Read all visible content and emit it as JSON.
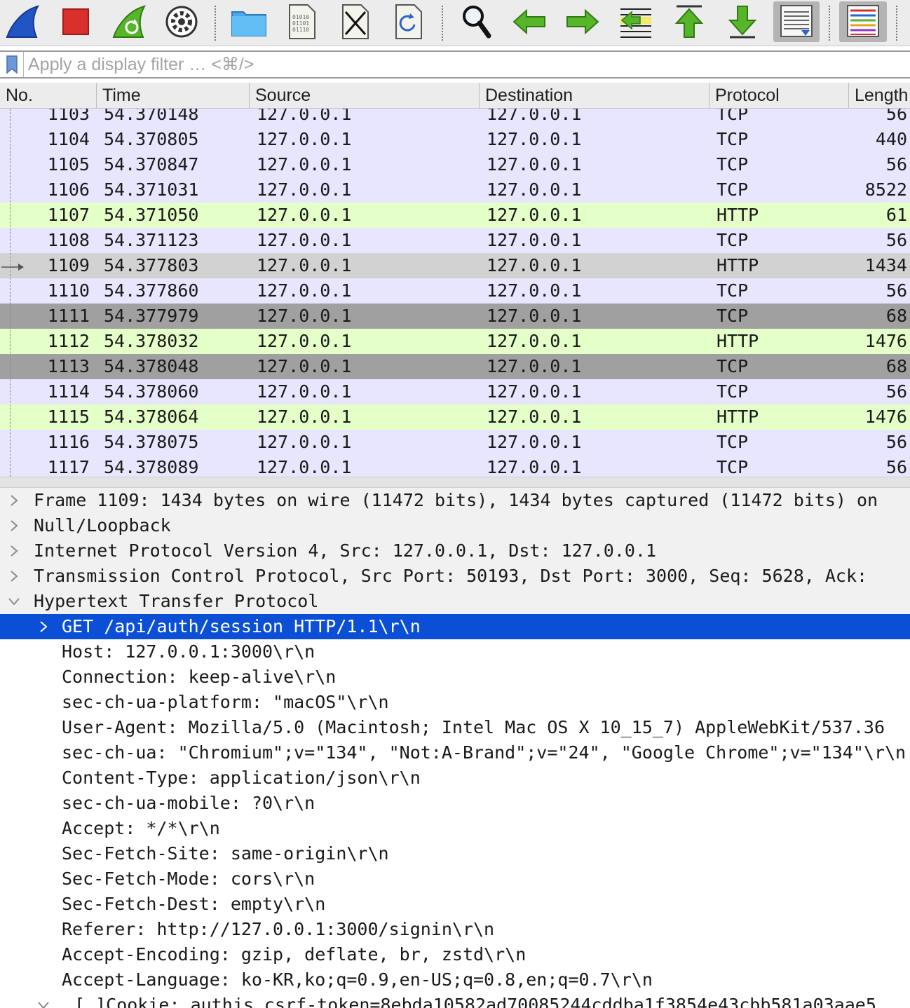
{
  "toolbar": {
    "buttons": [
      {
        "name": "start-capture-button",
        "icon": "shark-fin-icon"
      },
      {
        "name": "stop-capture-button",
        "icon": "stop-square-icon"
      },
      {
        "name": "restart-capture-button",
        "icon": "restart-fin-icon"
      },
      {
        "name": "capture-options-button",
        "icon": "gear-icon"
      },
      {
        "name": "open-file-button",
        "icon": "folder-icon"
      },
      {
        "name": "save-file-button",
        "icon": "binary-file-icon"
      },
      {
        "name": "close-file-button",
        "icon": "close-file-icon"
      },
      {
        "name": "reload-file-button",
        "icon": "reload-file-icon"
      },
      {
        "name": "find-packet-button",
        "icon": "magnifier-icon"
      },
      {
        "name": "go-back-button",
        "icon": "arrow-left-icon"
      },
      {
        "name": "go-forward-button",
        "icon": "arrow-right-icon"
      },
      {
        "name": "go-to-packet-button",
        "icon": "jump-to-packet-icon"
      },
      {
        "name": "first-packet-button",
        "icon": "arrow-up-icon"
      },
      {
        "name": "last-packet-button",
        "icon": "arrow-down-icon"
      },
      {
        "name": "autoscroll-button",
        "icon": "autoscroll-icon"
      },
      {
        "name": "colorize-button",
        "icon": "colorize-lines-icon"
      }
    ],
    "colors": {
      "accent_green": "#57b52a",
      "stop_red": "#d9302c",
      "fin_blue": "#2255c4",
      "folder_blue": "#4aa8e8"
    }
  },
  "filter": {
    "placeholder": "Apply a display filter … <⌘/>",
    "value": ""
  },
  "packet_list": {
    "columns": [
      "No.",
      "Time",
      "Source",
      "Destination",
      "Protocol",
      "Length"
    ],
    "row_colors": {
      "tcp": "#e7e6fe",
      "http": "#e4ffc7",
      "selected": "#d2d2d2",
      "bad_tcp": "#a0a0a0"
    },
    "rows": [
      {
        "no": "1103",
        "time": "54.370148",
        "source": "127.0.0.1",
        "destination": "127.0.0.1",
        "protocol": "TCP",
        "length": "56",
        "style": "tcp"
      },
      {
        "no": "1104",
        "time": "54.370805",
        "source": "127.0.0.1",
        "destination": "127.0.0.1",
        "protocol": "TCP",
        "length": "440",
        "style": "tcp"
      },
      {
        "no": "1105",
        "time": "54.370847",
        "source": "127.0.0.1",
        "destination": "127.0.0.1",
        "protocol": "TCP",
        "length": "56",
        "style": "tcp"
      },
      {
        "no": "1106",
        "time": "54.371031",
        "source": "127.0.0.1",
        "destination": "127.0.0.1",
        "protocol": "TCP",
        "length": "8522",
        "style": "tcp"
      },
      {
        "no": "1107",
        "time": "54.371050",
        "source": "127.0.0.1",
        "destination": "127.0.0.1",
        "protocol": "HTTP",
        "length": "61",
        "style": "http"
      },
      {
        "no": "1108",
        "time": "54.371123",
        "source": "127.0.0.1",
        "destination": "127.0.0.1",
        "protocol": "TCP",
        "length": "56",
        "style": "tcp"
      },
      {
        "no": "1109",
        "time": "54.377803",
        "source": "127.0.0.1",
        "destination": "127.0.0.1",
        "protocol": "HTTP",
        "length": "1434",
        "style": "selected"
      },
      {
        "no": "1110",
        "time": "54.377860",
        "source": "127.0.0.1",
        "destination": "127.0.0.1",
        "protocol": "TCP",
        "length": "56",
        "style": "tcp"
      },
      {
        "no": "1111",
        "time": "54.377979",
        "source": "127.0.0.1",
        "destination": "127.0.0.1",
        "protocol": "TCP",
        "length": "68",
        "style": "bad_tcp"
      },
      {
        "no": "1112",
        "time": "54.378032",
        "source": "127.0.0.1",
        "destination": "127.0.0.1",
        "protocol": "HTTP",
        "length": "1476",
        "style": "http"
      },
      {
        "no": "1113",
        "time": "54.378048",
        "source": "127.0.0.1",
        "destination": "127.0.0.1",
        "protocol": "TCP",
        "length": "68",
        "style": "bad_tcp"
      },
      {
        "no": "1114",
        "time": "54.378060",
        "source": "127.0.0.1",
        "destination": "127.0.0.1",
        "protocol": "TCP",
        "length": "56",
        "style": "tcp"
      },
      {
        "no": "1115",
        "time": "54.378064",
        "source": "127.0.0.1",
        "destination": "127.0.0.1",
        "protocol": "HTTP",
        "length": "1476",
        "style": "http"
      },
      {
        "no": "1116",
        "time": "54.378075",
        "source": "127.0.0.1",
        "destination": "127.0.0.1",
        "protocol": "TCP",
        "length": "56",
        "style": "tcp"
      },
      {
        "no": "1117",
        "time": "54.378089",
        "source": "127.0.0.1",
        "destination": "127.0.0.1",
        "protocol": "TCP",
        "length": "56",
        "style": "tcp"
      }
    ]
  },
  "details": {
    "selected_color": "#0a4fd6",
    "rows": [
      {
        "text": "Frame 1109: 1434 bytes on wire (11472 bits), 1434 bytes captured (11472 bits) on",
        "level": 0,
        "expander": "collapsed"
      },
      {
        "text": "Null/Loopback",
        "level": 0,
        "expander": "collapsed"
      },
      {
        "text": "Internet Protocol Version 4, Src: 127.0.0.1, Dst: 127.0.0.1",
        "level": 0,
        "expander": "collapsed"
      },
      {
        "text": "Transmission Control Protocol, Src Port: 50193, Dst Port: 3000, Seq: 5628, Ack:",
        "level": 0,
        "expander": "collapsed"
      },
      {
        "text": "Hypertext Transfer Protocol",
        "level": 0,
        "expander": "expanded"
      },
      {
        "text": "GET /api/auth/session HTTP/1.1\\r\\n",
        "level": 1,
        "expander": "collapsed",
        "selected": true
      },
      {
        "text": "Host: 127.0.0.1:3000\\r\\n",
        "level": 1,
        "expander": "none"
      },
      {
        "text": "Connection: keep-alive\\r\\n",
        "level": 1,
        "expander": "none"
      },
      {
        "text": "sec-ch-ua-platform: \"macOS\"\\r\\n",
        "level": 1,
        "expander": "none"
      },
      {
        "text": "User-Agent: Mozilla/5.0 (Macintosh; Intel Mac OS X 10_15_7) AppleWebKit/537.36",
        "level": 1,
        "expander": "none"
      },
      {
        "text": "sec-ch-ua: \"Chromium\";v=\"134\", \"Not:A-Brand\";v=\"24\", \"Google Chrome\";v=\"134\"\\r\\n",
        "level": 1,
        "expander": "none"
      },
      {
        "text": "Content-Type: application/json\\r\\n",
        "level": 1,
        "expander": "none"
      },
      {
        "text": "sec-ch-ua-mobile: ?0\\r\\n",
        "level": 1,
        "expander": "none"
      },
      {
        "text": "Accept: */*\\r\\n",
        "level": 1,
        "expander": "none"
      },
      {
        "text": "Sec-Fetch-Site: same-origin\\r\\n",
        "level": 1,
        "expander": "none"
      },
      {
        "text": "Sec-Fetch-Mode: cors\\r\\n",
        "level": 1,
        "expander": "none"
      },
      {
        "text": "Sec-Fetch-Dest: empty\\r\\n",
        "level": 1,
        "expander": "none"
      },
      {
        "text": "Referer: http://127.0.0.1:3000/signin\\r\\n",
        "level": 1,
        "expander": "none"
      },
      {
        "text": "Accept-Encoding: gzip, deflate, br, zstd\\r\\n",
        "level": 1,
        "expander": "none"
      },
      {
        "text": "Accept-Language: ko-KR,ko;q=0.9,en-US;q=0.8,en;q=0.7\\r\\n",
        "level": 1,
        "expander": "none"
      },
      {
        "text": "[…]Cookie: authjs.csrf-token=8ebda10582ad70085244cddba1f3854e43cbb581a03aae5",
        "level": 1,
        "expander": "expanded"
      }
    ]
  }
}
